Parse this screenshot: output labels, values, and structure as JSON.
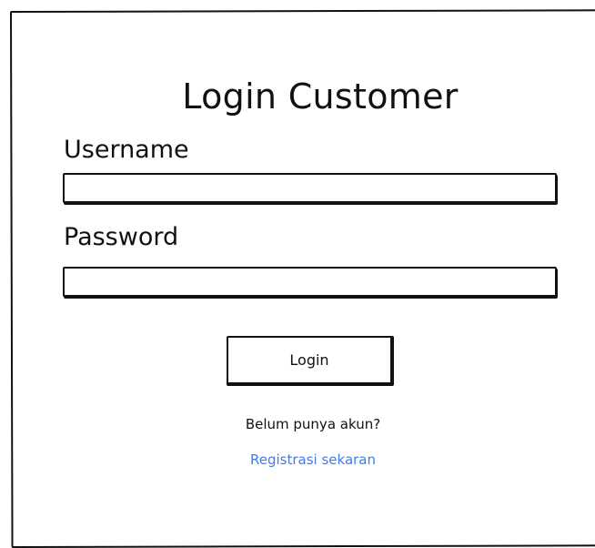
{
  "form": {
    "title": "Login Customer",
    "username_label": "Username",
    "username_value": "",
    "password_label": "Password",
    "password_value": "",
    "login_button": "Login",
    "register_prompt": "Belum punya akun?",
    "register_link": "Registrasi sekaran"
  },
  "colors": {
    "border": "#111111",
    "link": "#3c7bf0",
    "background": "#ffffff"
  }
}
